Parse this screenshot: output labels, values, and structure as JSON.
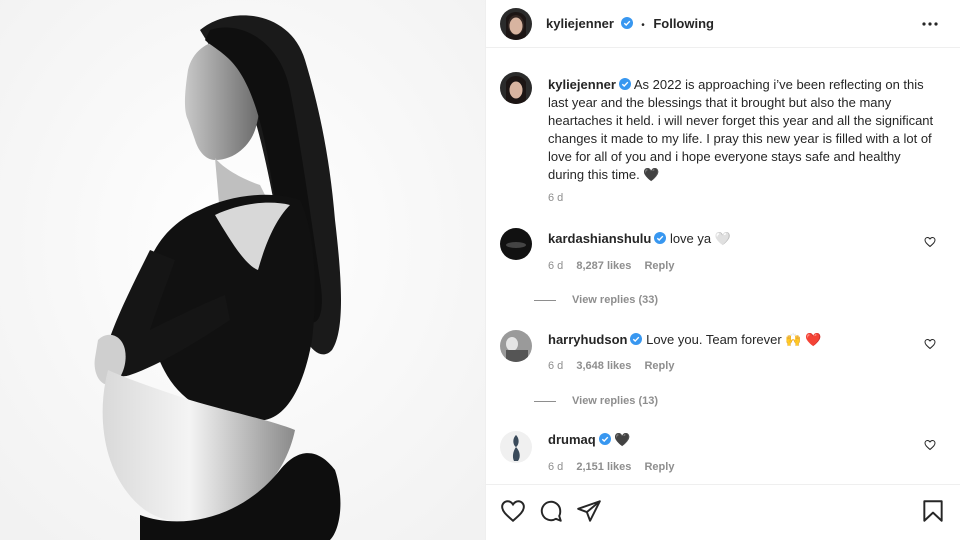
{
  "post": {
    "author": "kyliejenner",
    "follow_status": "Following",
    "separator": "•",
    "caption": "As 2022 is approaching i’ve been reflecting on this last year and the blessings that it brought but also the many heartaches it held. i will never forget this year and all the significant changes it made to my life. I pray this new year is filled with a lot of love for all of you and i hope everyone stays safe and healthy during this time. 🖤",
    "caption_age": "6 d"
  },
  "comments": [
    {
      "user": "kardashianshulu",
      "text": "love ya 🤍",
      "age": "6 d",
      "likes": "8,287 likes",
      "reply": "Reply",
      "view_replies": "View replies (33)"
    },
    {
      "user": "harryhudson",
      "text": "Love you. Team forever 🙌 ❤️",
      "age": "6 d",
      "likes": "3,648 likes",
      "reply": "Reply",
      "view_replies": "View replies (13)"
    },
    {
      "user": "drumaq",
      "text": "🖤",
      "age": "6 d",
      "likes": "2,151 likes",
      "reply": "Reply"
    }
  ],
  "icons": {
    "verified": "verified-badge-icon",
    "more": "more-options-icon",
    "like": "heart-icon",
    "comment": "comment-icon",
    "share": "send-icon",
    "save": "bookmark-icon"
  },
  "colors": {
    "verified": "#3897f0",
    "text": "#262626",
    "secondary": "#8e8e8e"
  }
}
